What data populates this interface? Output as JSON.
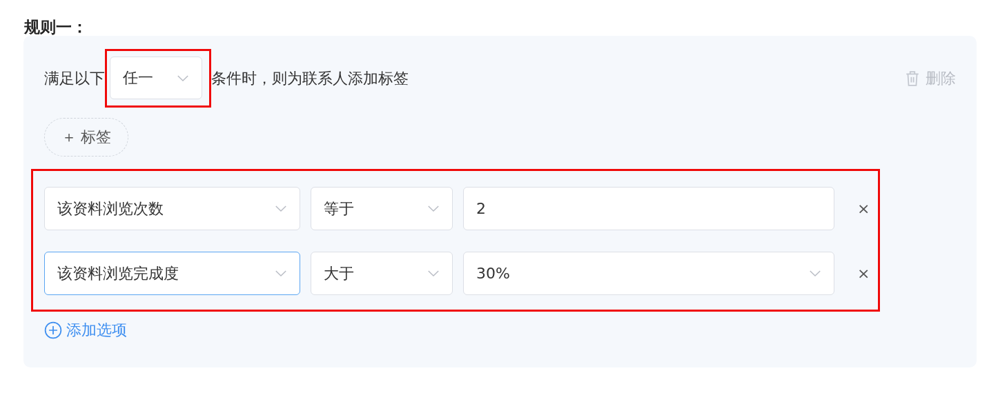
{
  "title": "规则一：",
  "rule": {
    "match_prefix": "满足以下",
    "match_mode": {
      "value": "任一",
      "highlighted": true
    },
    "match_suffix": "条件时，则为联系人添加标签",
    "delete_label": "删除",
    "tag_button": "＋ 标签",
    "conditions_highlighted": true,
    "conditions": [
      {
        "field": {
          "value": "该资料浏览次数",
          "focused": false
        },
        "operator": "等于",
        "value": {
          "kind": "input",
          "text": "2"
        },
        "remove": "×"
      },
      {
        "field": {
          "value": "该资料浏览完成度",
          "focused": true
        },
        "operator": "大于",
        "value": {
          "kind": "select",
          "text": "30%"
        },
        "remove": "×"
      }
    ],
    "add_option": "添加选项"
  }
}
